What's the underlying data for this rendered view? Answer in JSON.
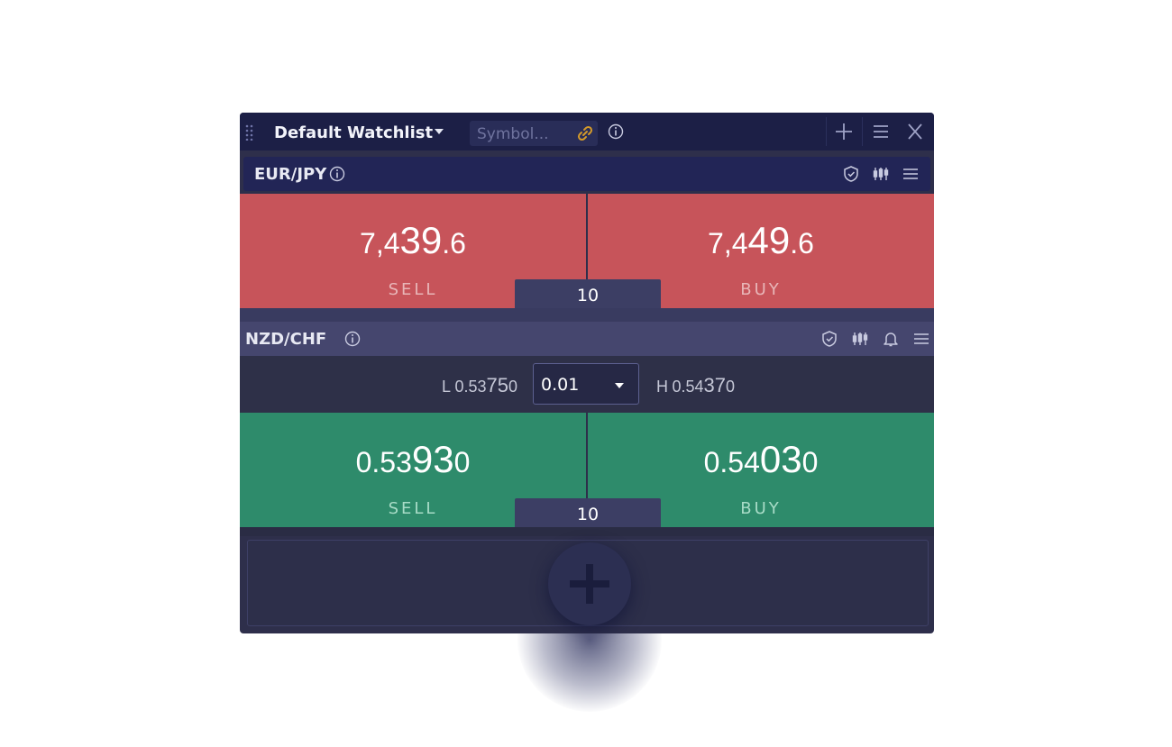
{
  "watchlist": {
    "title": "Default Watchlist",
    "symbol_placeholder": "Symbol...",
    "icons": [
      "drag-grip-icon",
      "caret-down-icon",
      "link-icon",
      "info-icon",
      "plus-icon",
      "menu-icon",
      "close-icon"
    ]
  },
  "instruments": [
    {
      "pair": "EUR/JPY",
      "sell": {
        "pre": "7,4",
        "big": "39",
        "post": ".6",
        "label": "SELL"
      },
      "buy": {
        "pre": "7,4",
        "big": "49",
        "post": ".6",
        "label": "BUY"
      },
      "quantity": "10",
      "color": "#c7545a",
      "icons": [
        "info-icon",
        "shield-icon",
        "candlestick-icon",
        "menu-icon"
      ]
    },
    {
      "pair": "NZD/CHF",
      "low": {
        "prefix": "L",
        "pre": "0.53",
        "big": "75",
        "post": "0"
      },
      "high": {
        "prefix": "H",
        "pre": "0.54",
        "big": "37",
        "post": "0"
      },
      "amount_select": "0.01",
      "sell": {
        "pre": "0.53",
        "big": "93",
        "post": "0",
        "label": "SELL"
      },
      "buy": {
        "pre": "0.54",
        "big": "03",
        "post": "0",
        "label": "BUY"
      },
      "quantity": "10",
      "color": "#2e8b6b",
      "icons": [
        "info-icon",
        "shield-icon",
        "candlestick-icon",
        "bell-icon",
        "menu-icon"
      ]
    }
  ],
  "add_button": {
    "icon": "plus-icon"
  }
}
